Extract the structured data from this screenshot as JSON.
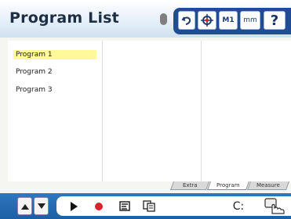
{
  "header": {
    "title": "Program List",
    "toolbar": {
      "m1_label": "M1",
      "mm_label": "mm",
      "help_label": "?"
    }
  },
  "programs": [
    {
      "label": "Program 1",
      "selected": true
    },
    {
      "label": "Program 2",
      "selected": false
    },
    {
      "label": "Program 3",
      "selected": false
    }
  ],
  "tabs": [
    {
      "label": "Extra",
      "active": false
    },
    {
      "label": "Program",
      "active": true
    },
    {
      "label": "Measure",
      "active": false
    }
  ],
  "bottom": {
    "drive_label": "C:"
  },
  "colors": {
    "selected_row": "#fff99a",
    "record_dot": "#e0202a",
    "toolbar_blue": "#1f4c94"
  },
  "icons": [
    "undo-icon",
    "probe-target-icon",
    "play-icon",
    "record-icon",
    "program-view-icon",
    "copy-icon",
    "touch-hand-icon",
    "arrow-up-icon",
    "arrow-down-icon",
    "mouse-icon"
  ]
}
